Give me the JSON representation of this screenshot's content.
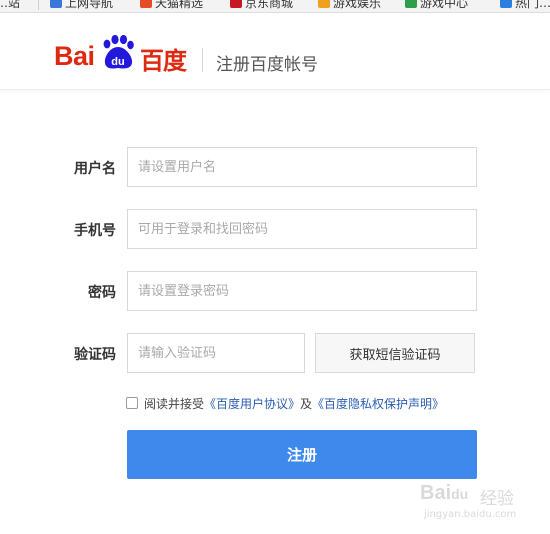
{
  "bookmarks": {
    "items": [
      {
        "label": "…站",
        "color": "#f3f3f3"
      },
      {
        "label": "上网导航",
        "color": "#3a76d8"
      },
      {
        "label": "天猫精选",
        "color": "#e44d26"
      },
      {
        "label": "京东商城",
        "color": "#c81623"
      },
      {
        "label": "游戏娱乐",
        "color": "#f0a020"
      },
      {
        "label": "游戏中心",
        "color": "#2e9e4b"
      },
      {
        "label": "热门…",
        "color": "#2b7de1"
      }
    ]
  },
  "header": {
    "logo_latin": "Bai",
    "logo_paw_text": "du",
    "logo_cn": "百度",
    "title": "注册百度帐号",
    "brand_color": "#de2910",
    "paw_color": "#2319dc"
  },
  "form": {
    "username": {
      "label": "用户名",
      "placeholder": "请设置用户名",
      "value": ""
    },
    "phone": {
      "label": "手机号",
      "placeholder": "可用于登录和找回密码",
      "value": ""
    },
    "password": {
      "label": "密码",
      "placeholder": "请设置登录密码",
      "value": ""
    },
    "captcha": {
      "label": "验证码",
      "placeholder": "请输入验证码",
      "value": "",
      "sms_button": "获取短信验证码"
    },
    "agreement": {
      "prefix": "阅读并接受",
      "link1": "《百度用户协议》",
      "and": "及",
      "link2": "《百度隐私权保护声明》",
      "checked": false
    },
    "submit_label": "注册",
    "submit_color": "#3f89ec"
  },
  "watermark": {
    "latin": "Bai",
    "paw": "du",
    "cn": "经验",
    "url": "jingyan.baidu.com"
  }
}
